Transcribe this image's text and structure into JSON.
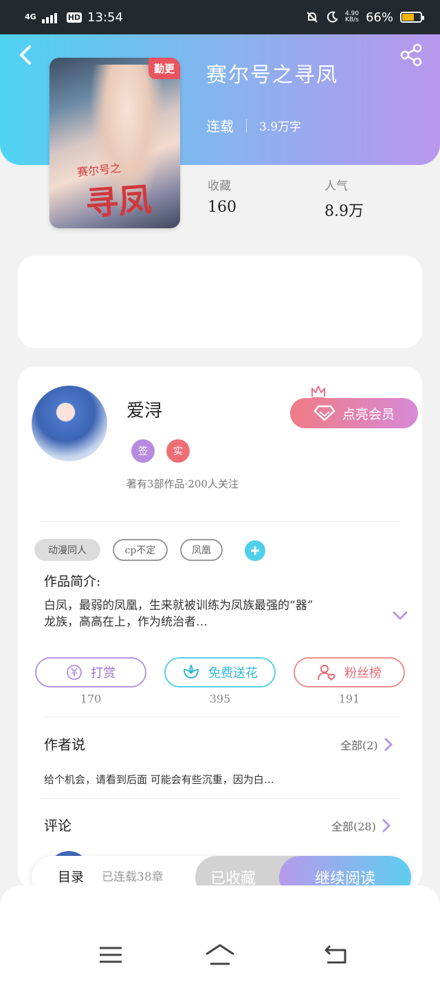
{
  "status_bar": {
    "network": "4G",
    "hd": "HD",
    "time": "13:54",
    "speed_value": "4.90",
    "speed_unit": "KB/s",
    "battery": "66%",
    "battery_level": 0.66
  },
  "book": {
    "title": "赛尔号之寻凤",
    "status": "连载",
    "word_count": "3.9万字",
    "update_tag": "勤更",
    "cover_small_text": "赛尔号之",
    "cover_big_text": "寻凤",
    "stats": {
      "favorites_label": "收藏",
      "favorites_value": "160",
      "popularity_label": "人气",
      "popularity_value": "8.9万"
    }
  },
  "author": {
    "name": "爱浔",
    "badge_sign": "签",
    "badge_real": "实",
    "meta": "著有3部作品·200人关注",
    "vip_button": "点亮会员"
  },
  "tags": [
    "动漫同人",
    "cp不定",
    "凤凰"
  ],
  "intro": {
    "title": "作品简介:",
    "line1": "白凤，最弱的凤凰，生来就被训练为凤族最强的“器”",
    "line2": "龙族，高高在上，作为统治者…"
  },
  "actions": {
    "reward_label": "打赏",
    "reward_count": "170",
    "flower_label": "免费送花",
    "flower_count": "395",
    "fans_label": "粉丝榜",
    "fans_count": "191"
  },
  "author_says": {
    "title": "作者说",
    "more": "全部(2)",
    "text": "给个机会，请看到后面 可能会有些沉重，因为白…"
  },
  "comments": {
    "title": "评论",
    "more": "全部(28)"
  },
  "bottom_bar": {
    "toc": "目录",
    "chapters": "已连载38章",
    "favorited": "已收藏",
    "continue_reading": "继续阅读"
  },
  "colors": {
    "header_start": "#4fd3f2",
    "header_end": "#b997ec",
    "vip_start": "#f07b86",
    "vip_end": "#d78ad7"
  }
}
